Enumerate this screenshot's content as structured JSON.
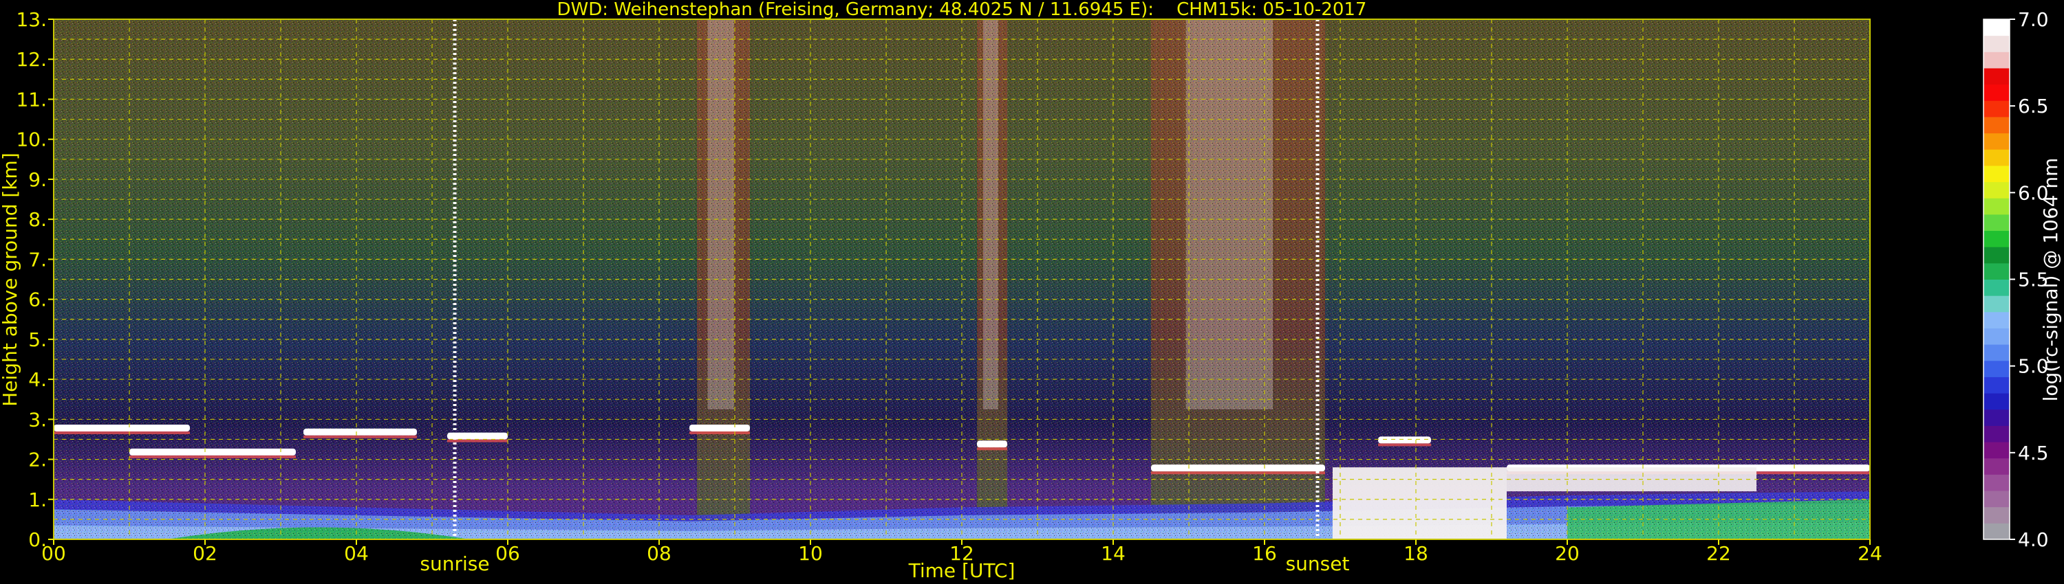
{
  "chart_data": {
    "type": "heatmap",
    "title": "DWD: Weihenstephan (Freising, Germany; 48.4025 N / 11.6945 E):    CHM15k: 05-10-2017",
    "xlabel": "Time [UTC]",
    "ylabel": "Height above ground [km]",
    "xlim": [
      0,
      24
    ],
    "ylim": [
      0,
      13
    ],
    "x_ticks": [
      "00",
      "02",
      "04",
      "06",
      "08",
      "10",
      "12",
      "14",
      "16",
      "18",
      "20",
      "22",
      "24"
    ],
    "y_ticks": [
      "0.",
      "1.",
      "2.",
      "3.",
      "4.",
      "5.",
      "6.",
      "7.",
      "8.",
      "9.",
      "10.",
      "11.",
      "12.",
      "13."
    ],
    "grid": true,
    "colorbar": {
      "label": "log(rc-signal) @ 1064 nm",
      "range": [
        4.0,
        7.0
      ],
      "tick_values": [
        4.0,
        4.5,
        5.0,
        5.5,
        6.0,
        6.5,
        7.0
      ],
      "tick_labels": [
        "4.0",
        "4.5",
        "5.0",
        "5.5",
        "6.0",
        "6.5",
        "7.0"
      ],
      "colors": [
        "#a0a0a8",
        "#a58aa5",
        "#a06aa0",
        "#9a509a",
        "#8c2d8c",
        "#7a1082",
        "#5a0c8c",
        "#3a10a0",
        "#2020c0",
        "#2a3ad8",
        "#3a60e8",
        "#5a88f0",
        "#7aa8f5",
        "#8ab8f8",
        "#70d0c8",
        "#30c090",
        "#20b050",
        "#109030",
        "#20c030",
        "#60d840",
        "#a0e830",
        "#d8f020",
        "#f8f010",
        "#f8c808",
        "#f89808",
        "#f86808",
        "#f83008",
        "#f80808",
        "#e80808",
        "#f0c0c0",
        "#f0e0e0",
        "#ffffff"
      ]
    },
    "annotations": [
      {
        "text": "sunrise",
        "x": 5.3
      },
      {
        "text": "sunset",
        "x": 16.7
      }
    ],
    "features": {
      "boundary_layer_top_km": [
        [
          0,
          1.0
        ],
        [
          4,
          0.8
        ],
        [
          8.4,
          0.6
        ],
        [
          12,
          0.8
        ],
        [
          16,
          0.9
        ],
        [
          20,
          1.1
        ],
        [
          24,
          1.2
        ]
      ],
      "cloud_layers": [
        {
          "start": 0.0,
          "end": 1.8,
          "base_km": 2.8
        },
        {
          "start": 1.0,
          "end": 3.2,
          "base_km": 2.2
        },
        {
          "start": 3.3,
          "end": 4.8,
          "base_km": 2.7
        },
        {
          "start": 5.2,
          "end": 6.0,
          "base_km": 2.6
        },
        {
          "start": 8.4,
          "end": 9.2,
          "base_km": 2.8
        },
        {
          "start": 12.2,
          "end": 12.6,
          "base_km": 2.4
        },
        {
          "start": 14.5,
          "end": 16.8,
          "base_km": 1.8
        },
        {
          "start": 17.5,
          "end": 18.2,
          "base_km": 2.5
        },
        {
          "start": 19.2,
          "end": 24.0,
          "base_km": 1.8
        }
      ],
      "precipitation_intervals": [
        [
          8.5,
          9.2
        ],
        [
          12.2,
          12.6
        ],
        [
          14.5,
          16.8
        ]
      ]
    }
  }
}
